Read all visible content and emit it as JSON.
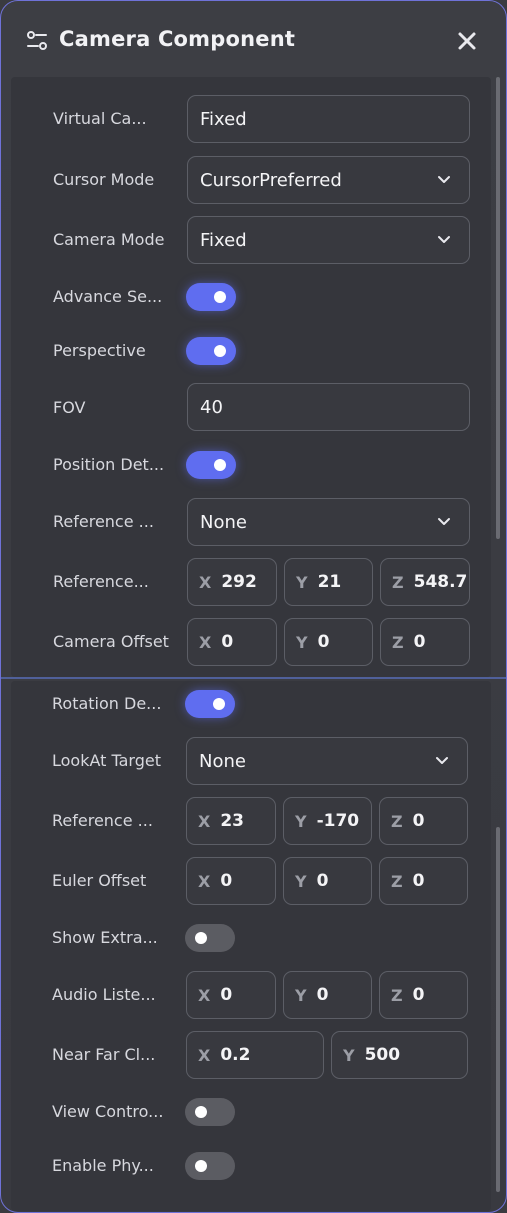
{
  "header": {
    "title": "Camera Component",
    "settings_icon": "sliders-icon",
    "close_icon": "close-icon"
  },
  "section1": {
    "virtual_camera": {
      "label": "Virtual Ca...",
      "value": "Fixed"
    },
    "cursor_mode": {
      "label": "Cursor Mode",
      "value": "CursorPreferred"
    },
    "camera_mode": {
      "label": "Camera Mode",
      "value": "Fixed"
    },
    "advance_settings": {
      "label": "Advance Se...",
      "on": true
    },
    "perspective": {
      "label": "Perspective",
      "on": true
    },
    "fov": {
      "label": "FOV",
      "value": "40"
    },
    "position_detail": {
      "label": "Position Det...",
      "on": true
    },
    "reference_target": {
      "label": "Reference ...",
      "value": "None"
    },
    "reference_position": {
      "label": "Reference...",
      "x": "292",
      "y": "21",
      "z": "548.7"
    },
    "camera_offset": {
      "label": "Camera Offset",
      "x": "0",
      "y": "0",
      "z": "0"
    }
  },
  "section2": {
    "rotation_detail": {
      "label": "Rotation De...",
      "on": true
    },
    "lookat_target": {
      "label": "LookAt Target",
      "value": "None"
    },
    "reference_rotation": {
      "label": "Reference ...",
      "x": "23",
      "y": "-170",
      "z": "0"
    },
    "euler_offset": {
      "label": "Euler Offset",
      "x": "0",
      "y": "0",
      "z": "0"
    },
    "show_extra": {
      "label": "Show Extra...",
      "on": false
    },
    "audio_listener": {
      "label": "Audio Liste...",
      "x": "0",
      "y": "0",
      "z": "0"
    },
    "near_far_clip": {
      "label": "Near Far Cl...",
      "x": "0.2",
      "y": "500"
    },
    "view_control": {
      "label": "View Contro...",
      "on": false
    },
    "enable_physics": {
      "label": "Enable Phy...",
      "on": false
    }
  },
  "axis_labels": {
    "x": "X",
    "y": "Y",
    "z": "Z"
  },
  "colors": {
    "accent": "#5f6df0",
    "panel": "#3a3b40",
    "border": "#6f72d8"
  }
}
